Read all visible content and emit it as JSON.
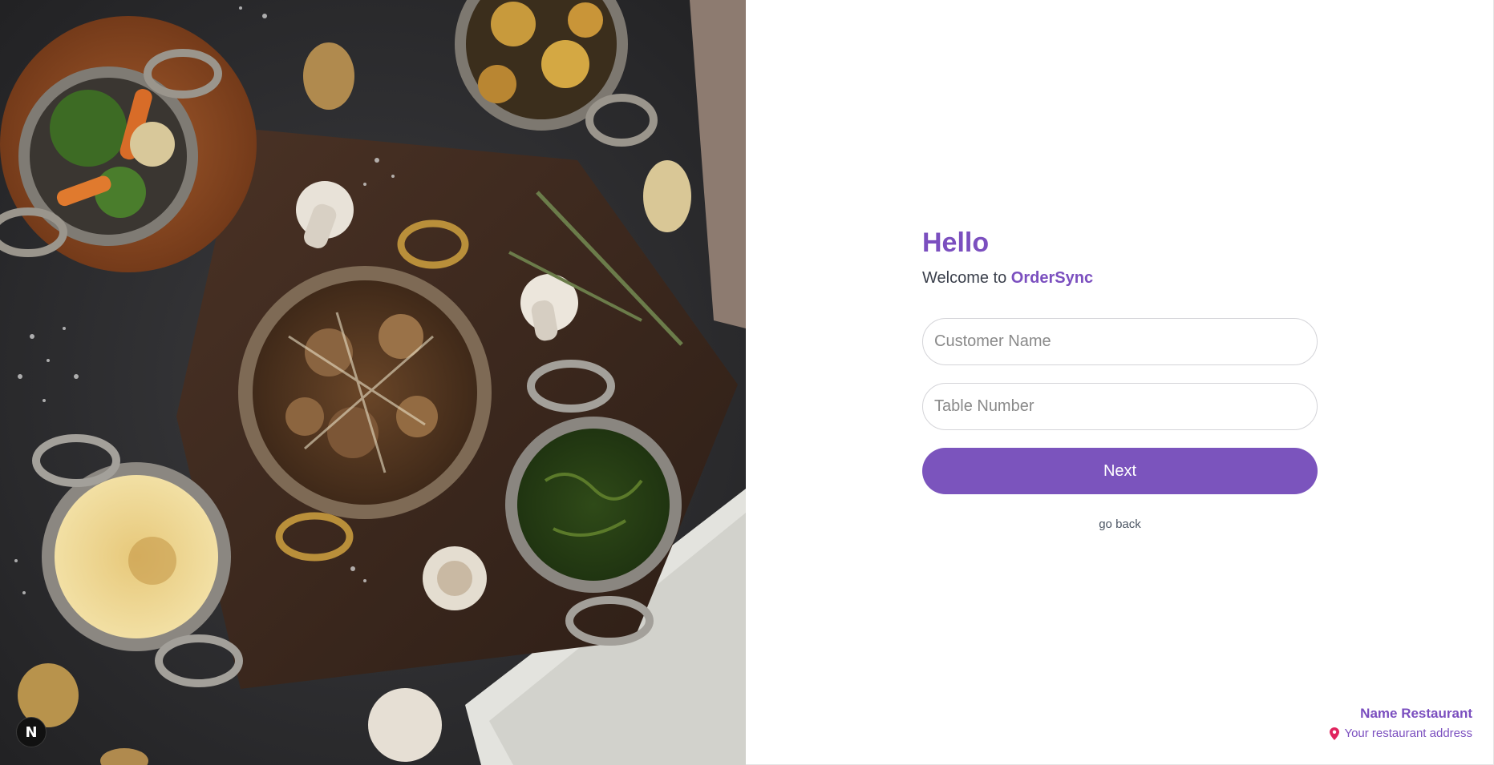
{
  "hero": {
    "description_icon": "food-photo-image",
    "badge_letter": "N"
  },
  "form": {
    "heading": "Hello",
    "welcome_prefix": "Welcome to",
    "brand": "OrderSync",
    "customer_name_placeholder": "Customer Name",
    "table_number_placeholder": "Table Number",
    "next_label": "Next",
    "go_back_label": "go back"
  },
  "footer": {
    "restaurant_name": "Name Restaurant",
    "address": "Your restaurant address",
    "pin_icon": "map-pin-icon"
  },
  "colors": {
    "accent": "#7b54bd",
    "text": "#3a3f4b",
    "border": "#d4d4d8"
  }
}
